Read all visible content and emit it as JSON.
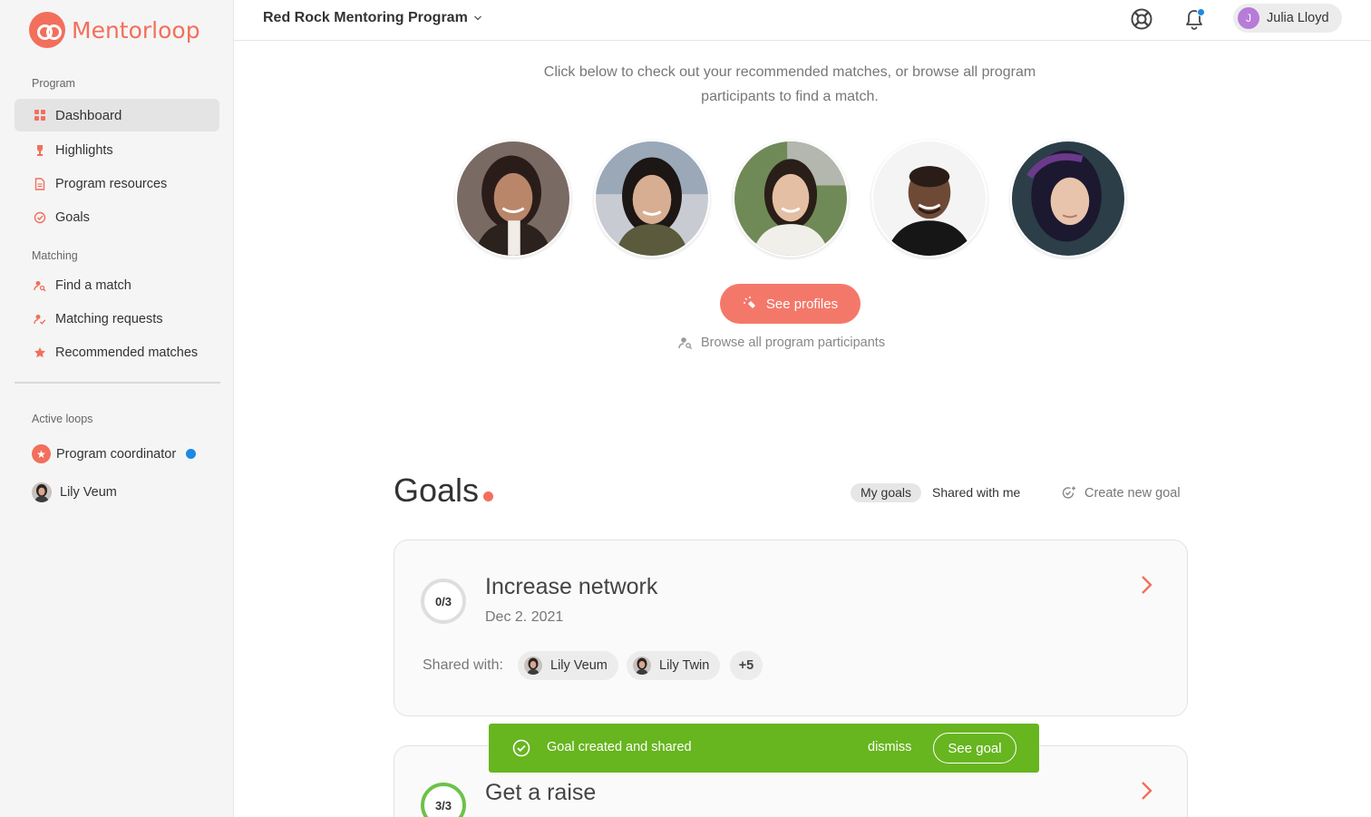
{
  "brand": {
    "name": "Mentorloop",
    "accent": "#f26f5c"
  },
  "sidebar": {
    "program_label": "Program",
    "program_items": [
      {
        "label": "Dashboard",
        "icon": "dashboard-grid-icon"
      },
      {
        "label": "Highlights",
        "icon": "trophy-icon"
      },
      {
        "label": "Program resources",
        "icon": "document-icon"
      },
      {
        "label": "Goals",
        "icon": "goal-check-icon"
      }
    ],
    "matching_label": "Matching",
    "matching_items": [
      {
        "label": "Find a match",
        "icon": "user-search-icon"
      },
      {
        "label": "Matching requests",
        "icon": "user-check-icon"
      },
      {
        "label": "Recommended matches",
        "icon": "star-icon"
      }
    ],
    "active_loops_label": "Active loops",
    "loops": [
      {
        "label": "Program coordinator",
        "icon": "star-badge-icon"
      },
      {
        "label": "Lily Veum",
        "icon": "avatar"
      }
    ]
  },
  "header": {
    "program_title": "Red Rock Mentoring Program",
    "user_initial": "J",
    "user_name": "Julia Lloyd"
  },
  "matches": {
    "intro": "Click below to check out your recommended matches, or browse all program participants to find a match.",
    "see_profiles": "See profiles",
    "browse_all": "Browse all program participants"
  },
  "goals": {
    "title": "Goals",
    "tab_my": "My goals",
    "tab_shared": "Shared with me",
    "create": "Create new goal",
    "items": [
      {
        "progress": "0/3",
        "name": "Increase network",
        "date": "Dec 2. 2021",
        "shared_label": "Shared with:",
        "shared_with": [
          "Lily Veum",
          "Lily Twin"
        ],
        "more": "+5"
      },
      {
        "progress": "3/3",
        "name": "Get a raise"
      }
    ]
  },
  "toast": {
    "message": "Goal created and shared",
    "dismiss": "dismiss",
    "action": "See goal",
    "color": "#67b51f"
  }
}
